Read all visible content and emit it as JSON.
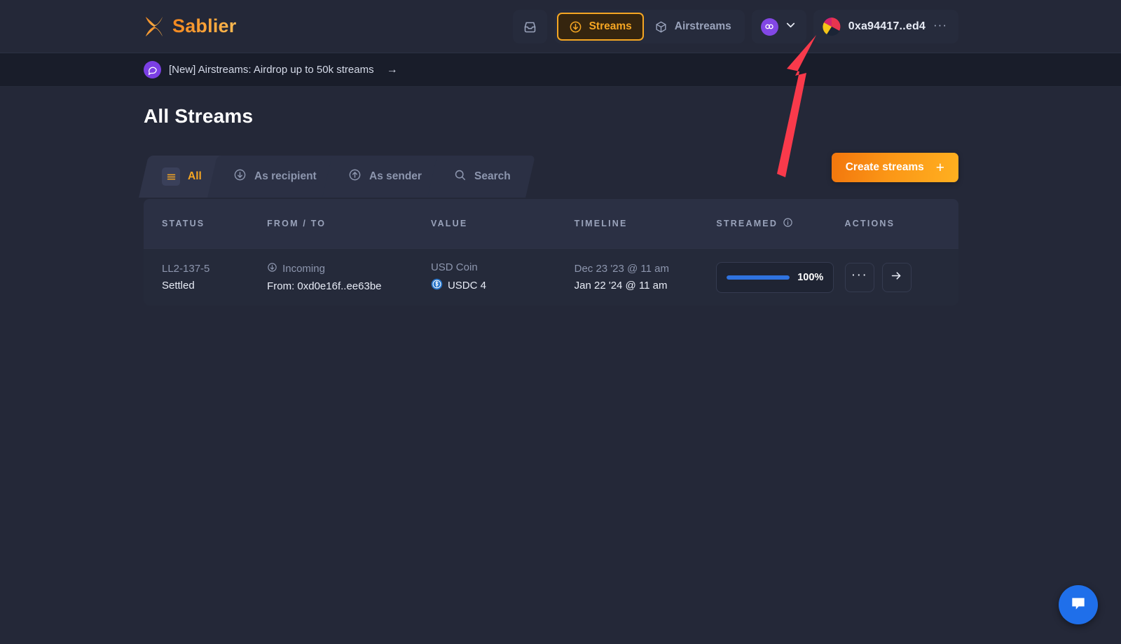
{
  "header": {
    "brand": "Sablier",
    "nav": {
      "inbox_label": "inbox-icon",
      "items": [
        {
          "label": "Streams",
          "icon": "download-circle-icon",
          "active": true
        },
        {
          "label": "Airstreams",
          "icon": "package-icon",
          "active": false
        }
      ],
      "chain": {
        "icon": "chain-link-icon",
        "chevron": "chevron-down-icon"
      },
      "wallet": {
        "address": "0xa94417..ed4",
        "more": "···"
      }
    }
  },
  "banner": {
    "icon": "chat-bubble-icon",
    "text": "[New] Airstreams: Airdrop up to 50k streams",
    "arrow": "→"
  },
  "main": {
    "title": "All Streams",
    "tabs": [
      {
        "label": "All",
        "icon": "hamburger-icon",
        "active": true
      },
      {
        "label": "As recipient",
        "icon": "arrow-down-circle-icon",
        "active": false
      },
      {
        "label": "As sender",
        "icon": "arrow-up-circle-icon",
        "active": false
      },
      {
        "label": "Search",
        "icon": "search-icon",
        "active": false
      }
    ],
    "create_button": {
      "label": "Create streams",
      "plus": "+"
    },
    "table": {
      "columns": [
        "STATUS",
        "FROM / TO",
        "VALUE",
        "TIMELINE",
        "STREAMED",
        "ACTIONS"
      ],
      "streamed_info_icon": "info-icon",
      "rows": [
        {
          "status_id": "LL2-137-5",
          "status": "Settled",
          "direction": "Incoming",
          "direction_icon": "arrow-down-circle-icon",
          "from": "From: 0xd0e16f..ee63be",
          "asset_name": "USD Coin",
          "asset_symbol": "USDC 4",
          "asset_icon": "usdc-icon",
          "start_date": "Dec 23 '23 @ 11 am",
          "end_date": "Jan 22 '24 @ 11 am",
          "progress_percent": 100,
          "progress_label": "100%",
          "action_more": "···",
          "action_open": "→"
        }
      ]
    }
  },
  "chat_widget": {
    "icon": "chat-bubble-icon"
  },
  "annotation": {
    "arrow": "red-pointer-arrow"
  },
  "colors": {
    "accent_orange": "#f5a623",
    "brand_gradient_start": "#f2760d",
    "brand_gradient_end": "#ffb020",
    "progress_blue": "#2f73e0",
    "chain_purple": "#8247e5",
    "banner_purple": "#7b3fe4",
    "chat_blue": "#1f6fea",
    "annotation_red": "#f93a4b",
    "bg_page": "#242838",
    "bg_banner": "#191d2a",
    "bg_table_head": "#2b3044",
    "bg_table_row": "#252a3a"
  }
}
